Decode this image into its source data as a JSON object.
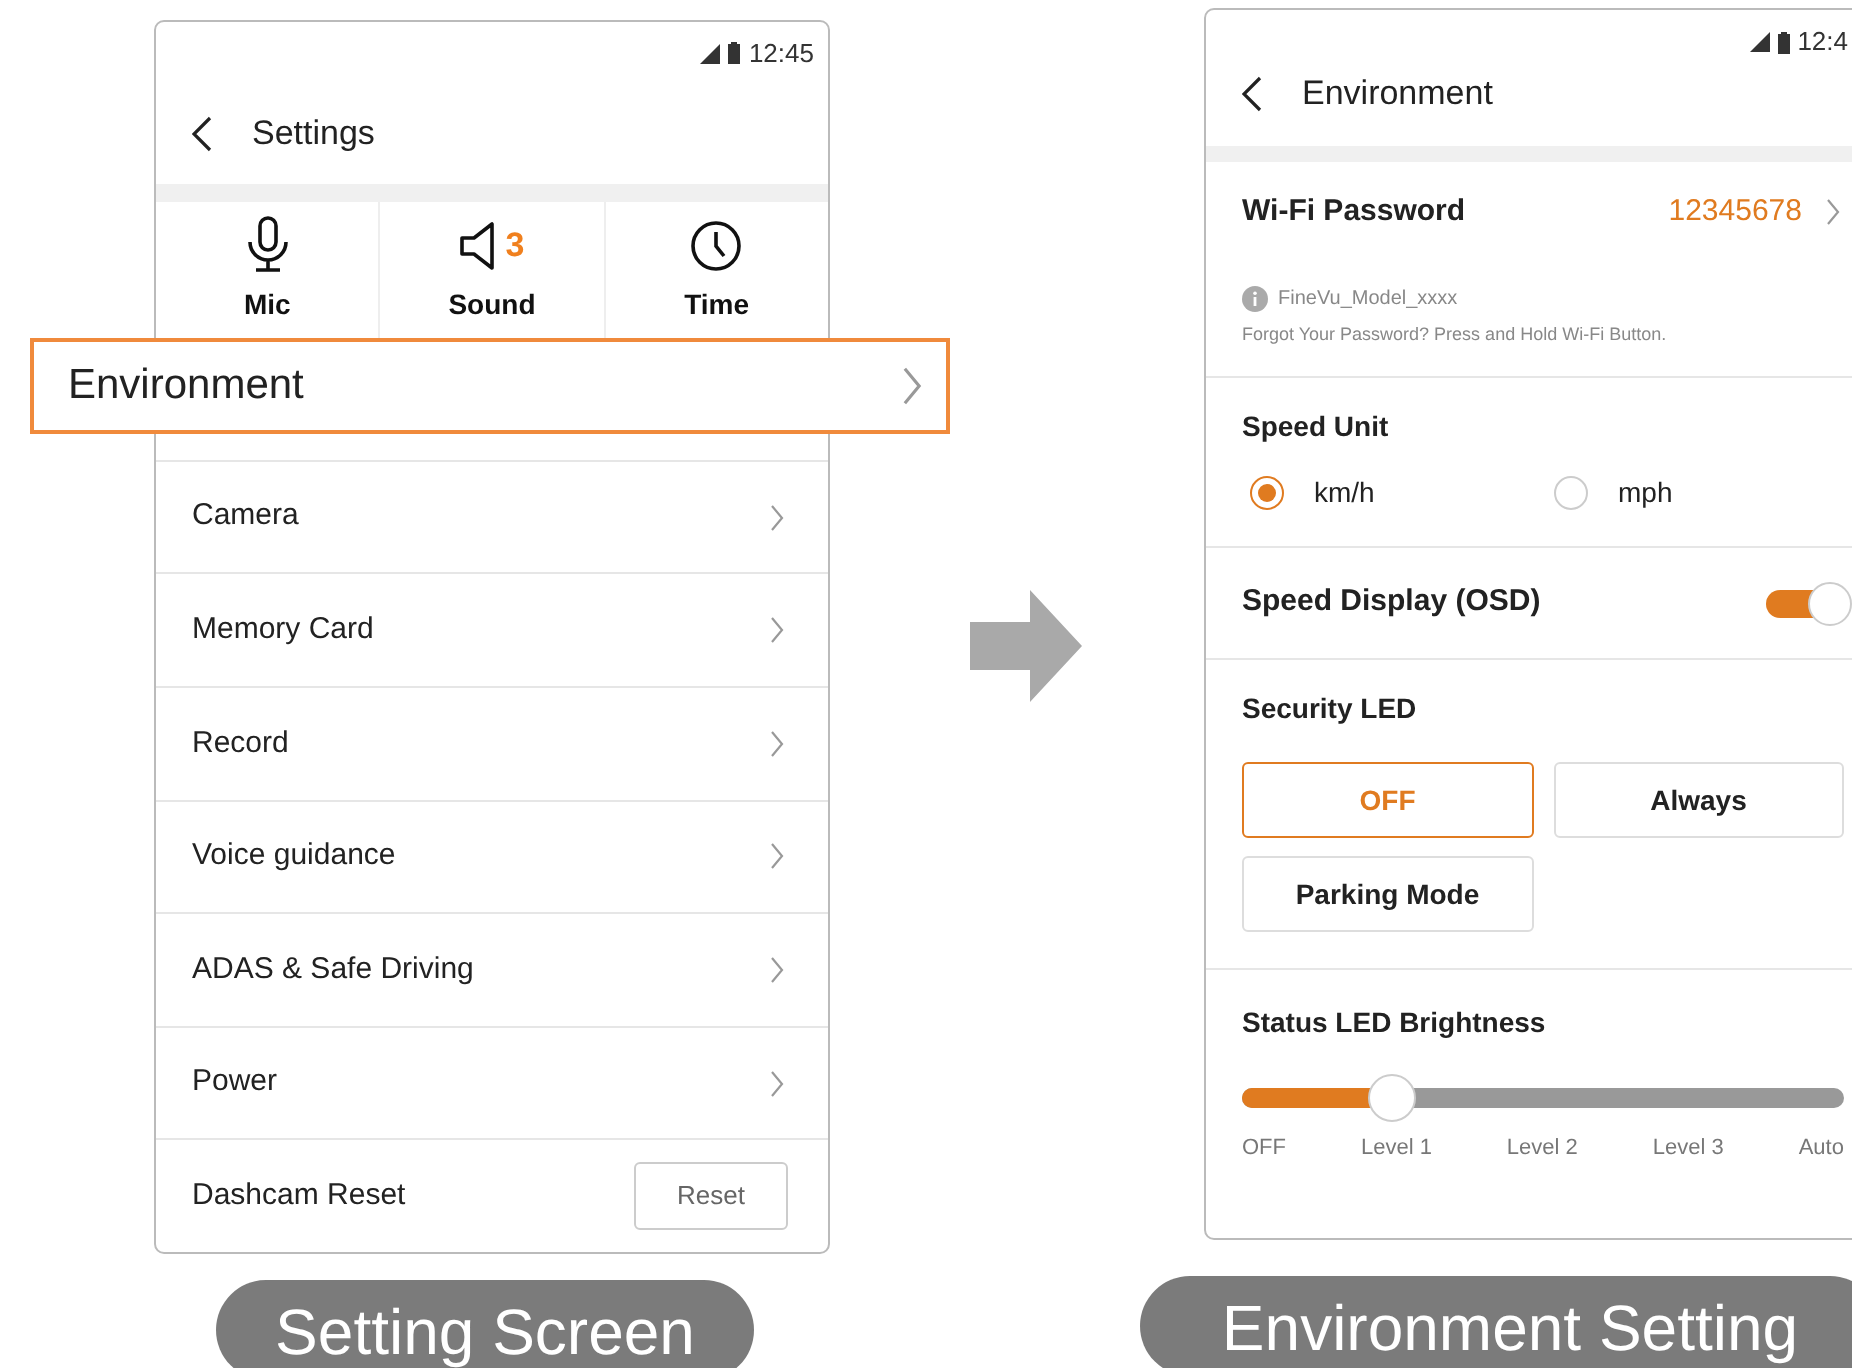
{
  "left": {
    "status_time": "12:45",
    "title": "Settings",
    "quick": [
      {
        "kind": "mic",
        "label": "Mic"
      },
      {
        "kind": "sound",
        "label": "Sound",
        "badge": "3"
      },
      {
        "kind": "time",
        "label": "Time"
      }
    ],
    "highlight": "Environment",
    "menu": [
      "Camera",
      "Memory Card",
      "Record",
      "Voice guidance",
      "ADAS & Safe Driving",
      "Power"
    ],
    "reset": {
      "label": "Dashcam Reset",
      "button": "Reset"
    },
    "caption": "Setting Screen"
  },
  "right": {
    "status_time": "12:4",
    "title": "Environment",
    "wifi": {
      "label": "Wi-Fi Password",
      "value": "12345678",
      "ssid": "FineVu_Model_xxxx",
      "hint": "Forgot Your Password? Press and Hold Wi-Fi Button."
    },
    "speed_unit": {
      "label": "Speed Unit",
      "options": [
        {
          "label": "km/h",
          "selected": true
        },
        {
          "label": "mph",
          "selected": false
        }
      ]
    },
    "osd": {
      "label": "Speed Display (OSD)",
      "on": true
    },
    "security_led": {
      "label": "Security LED",
      "options": [
        {
          "label": "OFF",
          "selected": true
        },
        {
          "label": "Always",
          "selected": false
        },
        {
          "label": "Parking Mode",
          "selected": false
        }
      ]
    },
    "brightness": {
      "label": "Status LED Brightness",
      "level": 0.25,
      "ticks": [
        "OFF",
        "Level 1",
        "Level 2",
        "Level 3",
        "Auto"
      ]
    },
    "caption": "Environment Setting"
  }
}
